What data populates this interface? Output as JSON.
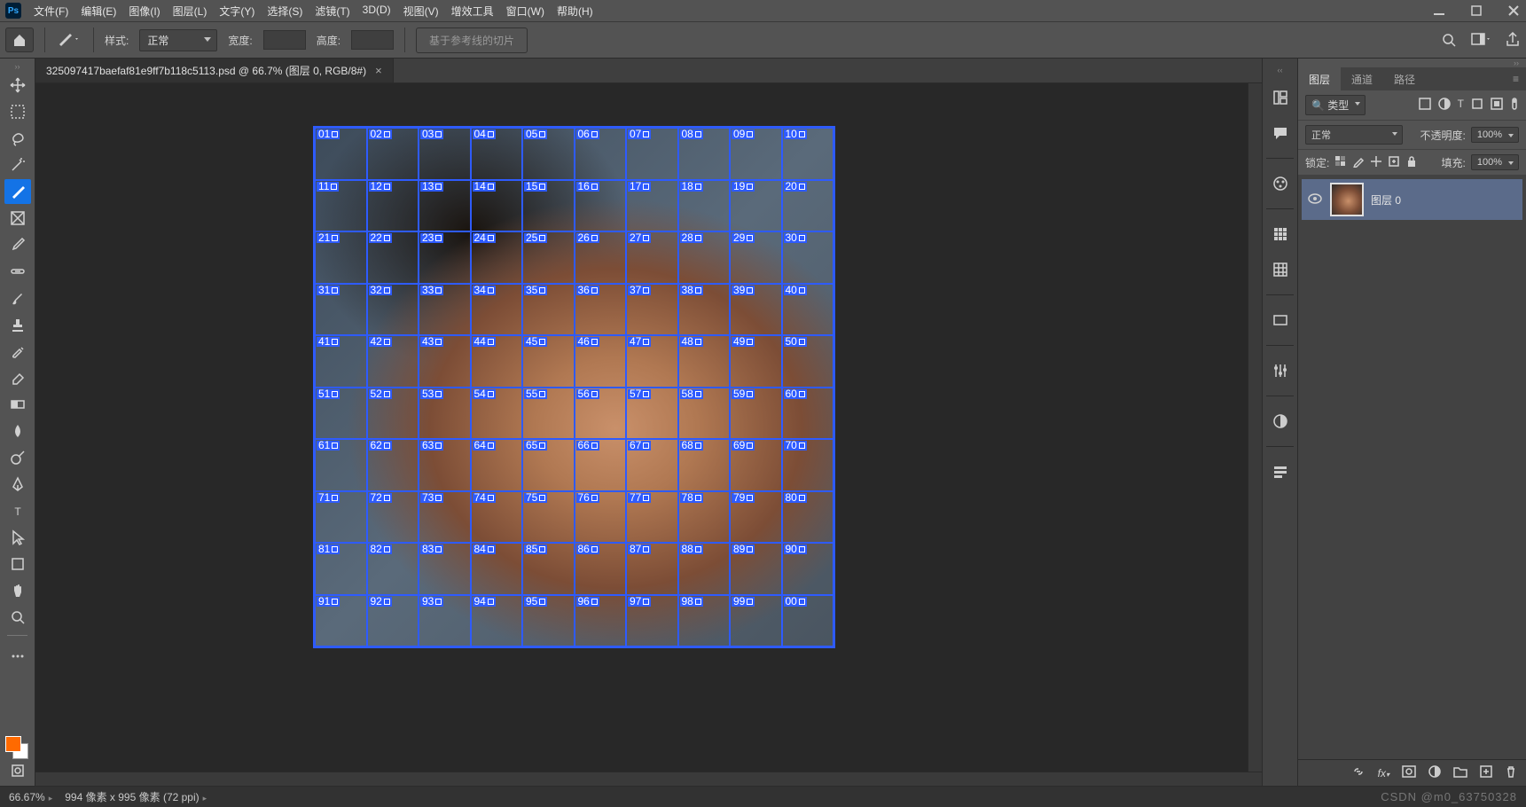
{
  "app": {
    "logo": "Ps"
  },
  "menu": [
    "文件(F)",
    "编辑(E)",
    "图像(I)",
    "图层(L)",
    "文字(Y)",
    "选择(S)",
    "滤镜(T)",
    "3D(D)",
    "视图(V)",
    "增效工具",
    "窗口(W)",
    "帮助(H)"
  ],
  "options": {
    "style_label": "样式:",
    "style_value": "正常",
    "width_label": "宽度:",
    "height_label": "高度:",
    "slice_btn": "基于参考线的切片"
  },
  "doc": {
    "tab_title": "325097417baefaf81e9ff7b118c5113.psd @ 66.7% (图层 0, RGB/8#)"
  },
  "slices": {
    "cols": 10,
    "rows": 10,
    "last_label": "00"
  },
  "layers_panel": {
    "tabs": [
      "图层",
      "通道",
      "路径"
    ],
    "kind_label": "类型",
    "blend_value": "正常",
    "opacity_label": "不透明度:",
    "opacity_value": "100%",
    "lock_label": "锁定:",
    "fill_label": "填充:",
    "fill_value": "100%",
    "layer0": "图层 0"
  },
  "status": {
    "zoom": "66.67%",
    "docinfo": "994 像素 x 995 像素 (72 ppi)",
    "watermark": "CSDN @m0_63750328"
  },
  "colors": {
    "fg": "#ff6a00",
    "bg": "#ffffff"
  }
}
